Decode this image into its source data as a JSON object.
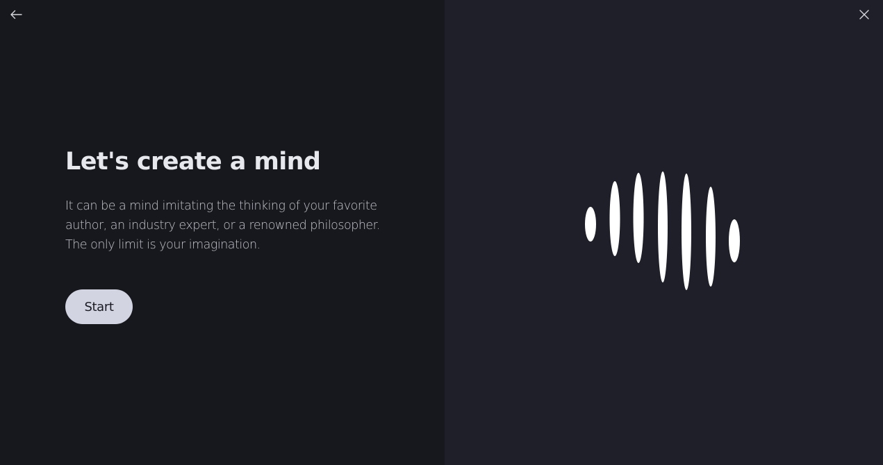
{
  "nav": {
    "back_icon": "arrow-left-icon",
    "close_icon": "close-icon"
  },
  "hero": {
    "title": "Let's create a mind",
    "description_line1": "It can be a mind imitating the thinking of your favorite",
    "description_line2": "author, an industry expert, or a renowned philosopher.",
    "description_line3": "The only limit is your imagination.",
    "start_label": "Start"
  },
  "illustration": {
    "icon": "sound-wave-icon",
    "color": "#ffffff"
  },
  "colors": {
    "left_background": "#17181d",
    "right_background": "#1e1f28",
    "button_background": "#d3d4e2",
    "title_color": "#e7e8ee",
    "text_color": "#c4c5cd"
  }
}
